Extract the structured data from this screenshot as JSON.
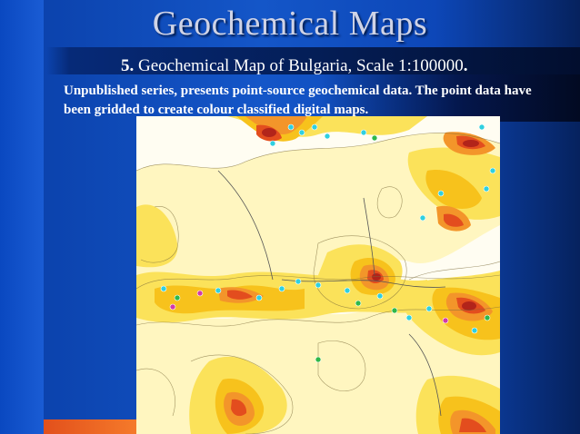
{
  "slide": {
    "title": "Geochemical Maps",
    "item_number": "5.",
    "item_text": " Geochemical Map of Bulgaria, Scale 1:100000",
    "item_end": ".",
    "description": "Unpublished series, presents point-source geochemical data. The point data have been gridded to create colour classified digital maps."
  },
  "map": {
    "colors": {
      "pale": "#fff6c0",
      "yellow": "#fbe25a",
      "gold": "#f7c21c",
      "orange": "#f3952a",
      "red": "#e34d1e",
      "dark_red": "#b2241a",
      "contour": "#7a6b3a",
      "site_cyan": "#2fd0e0",
      "site_green": "#2fb84a",
      "site_magenta": "#d23aa8"
    }
  }
}
